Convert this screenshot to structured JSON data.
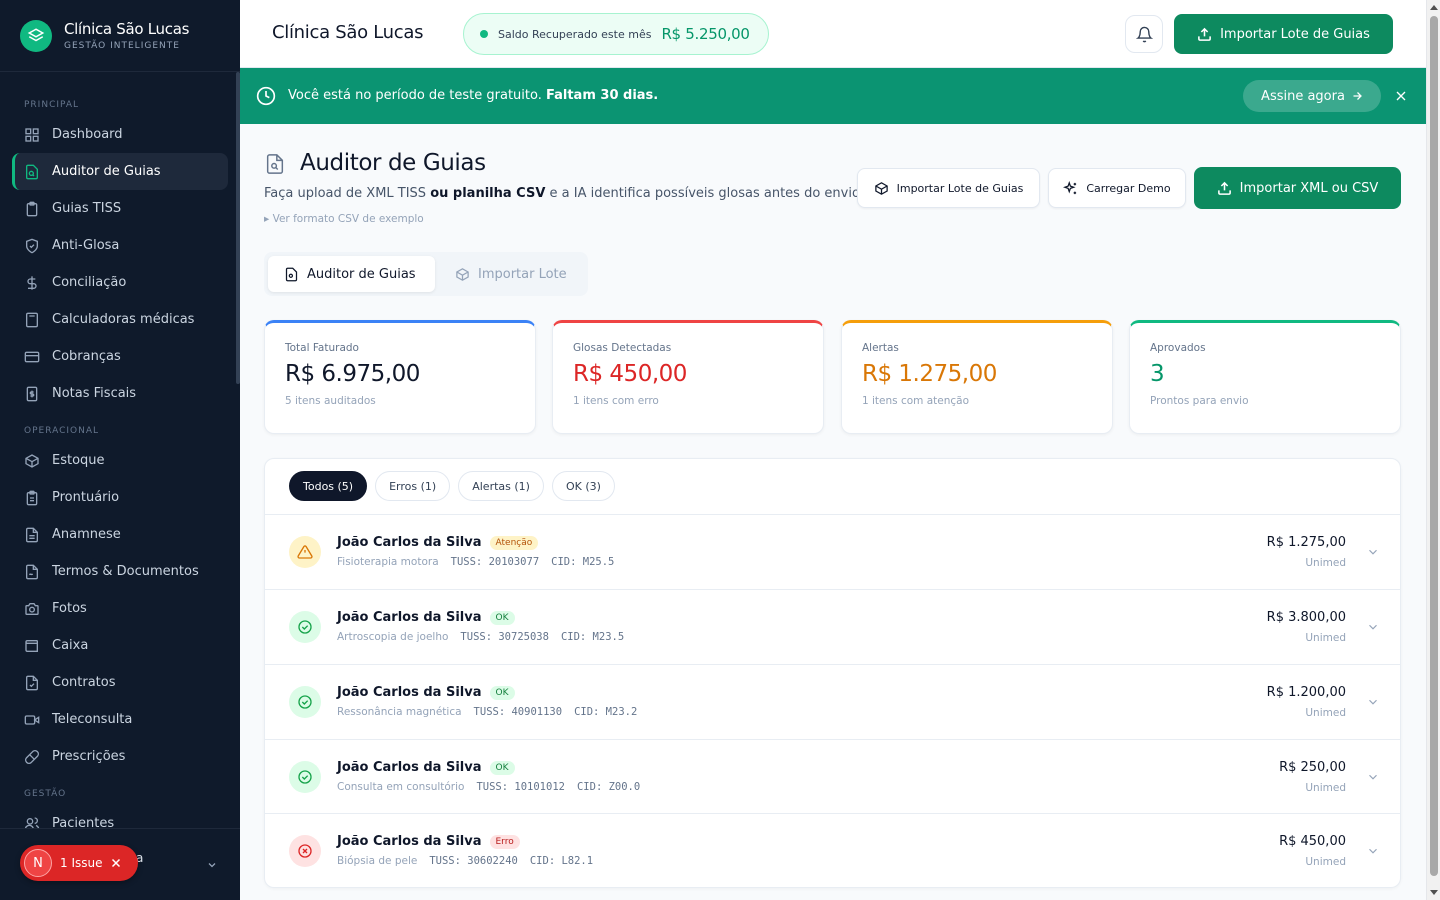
{
  "brand": {
    "name": "Clínica São Lucas",
    "subtitle": "GESTÃO INTELIGENTE"
  },
  "sidebar": {
    "sections": [
      {
        "title": "PRINCIPAL"
      },
      {
        "title": "OPERACIONAL"
      },
      {
        "title": "GESTÃO"
      }
    ],
    "items": [
      {
        "label": "Dashboard",
        "icon": "grid-icon"
      },
      {
        "label": "Auditor de Guias",
        "icon": "file-search-icon",
        "active": true
      },
      {
        "label": "Guias TISS",
        "icon": "clipboard-icon"
      },
      {
        "label": "Anti-Glosa",
        "icon": "shield-icon"
      },
      {
        "label": "Conciliação",
        "icon": "dollar-icon"
      },
      {
        "label": "Calculadoras médicas",
        "icon": "calculator-icon"
      },
      {
        "label": "Cobranças",
        "icon": "credit-card-icon"
      },
      {
        "label": "Notas Fiscais",
        "icon": "receipt-icon"
      },
      {
        "label": "Estoque",
        "icon": "package-icon"
      },
      {
        "label": "Prontuário",
        "icon": "clipboard-list-icon"
      },
      {
        "label": "Anamnese",
        "icon": "file-text-icon"
      },
      {
        "label": "Termos & Documentos",
        "icon": "file-signature-icon"
      },
      {
        "label": "Fotos",
        "icon": "camera-icon"
      },
      {
        "label": "Caixa",
        "icon": "wallet-icon"
      },
      {
        "label": "Contratos",
        "icon": "file-contract-icon"
      },
      {
        "label": "Teleconsulta",
        "icon": "video-icon"
      },
      {
        "label": "Prescrições",
        "icon": "pill-icon"
      },
      {
        "label": "Pacientes",
        "icon": "users-icon"
      }
    ],
    "issue": {
      "avatar": "N",
      "label": "1 Issue",
      "peek": "a"
    }
  },
  "header": {
    "title": "Clínica São Lucas",
    "saldo_label": "Saldo Recuperado este mês",
    "saldo_value": "R$ 5.250,00",
    "import_button": "Importar Lote de Guias"
  },
  "banner": {
    "text": "Você está no período de teste gratuito.",
    "strong": "Faltam 30 dias.",
    "cta": "Assine agora"
  },
  "page": {
    "title": "Auditor de Guias",
    "desc_1": "Faça upload de XML TISS",
    "desc_b1": "ou planilha CSV",
    "desc_2": "e a IA identifica possíveis glosas antes do envio.",
    "csv_toggle": "▸ Ver formato CSV de exemplo",
    "btn_lote": "Importar Lote de Guias",
    "btn_demo": "Carregar Demo",
    "btn_primary": "Importar XML ou CSV"
  },
  "tabs": [
    {
      "label": "Auditor de Guias"
    },
    {
      "label": "Importar Lote"
    }
  ],
  "stats": [
    {
      "label": "Total Faturado",
      "value": "R$ 6.975,00",
      "sub": "5 itens auditados",
      "color": "#3b82f6",
      "value_color": "#0f172a"
    },
    {
      "label": "Glosas Detectadas",
      "value": "R$ 450,00",
      "sub": "1 itens com erro",
      "color": "#ef4444",
      "value_color": "#dc2626"
    },
    {
      "label": "Alertas",
      "value": "R$ 1.275,00",
      "sub": "1 itens com atenção",
      "color": "#f59e0b",
      "value_color": "#d97706"
    },
    {
      "label": "Aprovados",
      "value": "3",
      "sub": "Prontos para envio",
      "color": "#10b981",
      "value_color": "#059669"
    }
  ],
  "filters": [
    "Todos (5)",
    "Erros (1)",
    "Alertas (1)",
    "OK (3)"
  ],
  "rows": [
    {
      "name": "João Carlos da Silva",
      "status": "Atenção",
      "procedure": "Fisioterapia motora",
      "tuss": "TUSS: 20103077",
      "cid": "CID: M25.5",
      "amount": "R$ 1.275,00",
      "payer": "Unimed"
    },
    {
      "name": "João Carlos da Silva",
      "status": "OK",
      "procedure": "Artroscopia de joelho",
      "tuss": "TUSS: 30725038",
      "cid": "CID: M23.5",
      "amount": "R$ 3.800,00",
      "payer": "Unimed"
    },
    {
      "name": "João Carlos da Silva",
      "status": "OK",
      "procedure": "Ressonância magnética",
      "tuss": "TUSS: 40901130",
      "cid": "CID: M23.2",
      "amount": "R$ 1.200,00",
      "payer": "Unimed"
    },
    {
      "name": "João Carlos da Silva",
      "status": "OK",
      "procedure": "Consulta em consultório",
      "tuss": "TUSS: 10101012",
      "cid": "CID: Z00.0",
      "amount": "R$ 250,00",
      "payer": "Unimed"
    },
    {
      "name": "João Carlos da Silva",
      "status": "Erro",
      "procedure": "Biópsia de pele",
      "tuss": "TUSS: 30602240",
      "cid": "CID: L82.1",
      "amount": "R$ 450,00",
      "payer": "Unimed"
    }
  ],
  "colors": {
    "accent": "#0d8a5f",
    "sidebar": "#0f1a2b",
    "banner": "#0b9472"
  }
}
